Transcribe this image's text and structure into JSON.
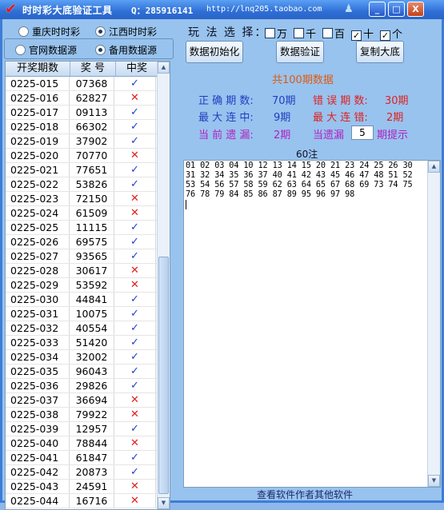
{
  "titlebar": {
    "title": "时时彩大底验证工具",
    "qq": "Q：285916141",
    "url": "http://lnq205.taobao.com",
    "min_label": "_",
    "max_label": "□",
    "close_label": "X"
  },
  "lottery_options": [
    {
      "label": "重庆时时彩",
      "selected": false
    },
    {
      "label": "江西时时彩",
      "selected": true
    }
  ],
  "source_options": [
    {
      "label": "官网数据源",
      "selected": false
    },
    {
      "label": "备用数据源",
      "selected": true
    }
  ],
  "grid": {
    "headers": [
      "开奖期数",
      "奖 号",
      "中奖"
    ],
    "rows": [
      {
        "period": "0225-015",
        "number": "07368",
        "hit": "✓"
      },
      {
        "period": "0225-016",
        "number": "62827",
        "hit": "✕"
      },
      {
        "period": "0225-017",
        "number": "09113",
        "hit": "✓"
      },
      {
        "period": "0225-018",
        "number": "66302",
        "hit": "✓"
      },
      {
        "period": "0225-019",
        "number": "37902",
        "hit": "✓"
      },
      {
        "period": "0225-020",
        "number": "70770",
        "hit": "✕"
      },
      {
        "period": "0225-021",
        "number": "77651",
        "hit": "✓"
      },
      {
        "period": "0225-022",
        "number": "53826",
        "hit": "✓"
      },
      {
        "period": "0225-023",
        "number": "72150",
        "hit": "✕"
      },
      {
        "period": "0225-024",
        "number": "61509",
        "hit": "✕"
      },
      {
        "period": "0225-025",
        "number": "11115",
        "hit": "✓"
      },
      {
        "period": "0225-026",
        "number": "69575",
        "hit": "✓"
      },
      {
        "period": "0225-027",
        "number": "93565",
        "hit": "✓"
      },
      {
        "period": "0225-028",
        "number": "30617",
        "hit": "✕"
      },
      {
        "period": "0225-029",
        "number": "53592",
        "hit": "✕"
      },
      {
        "period": "0225-030",
        "number": "44841",
        "hit": "✓"
      },
      {
        "period": "0225-031",
        "number": "10075",
        "hit": "✓"
      },
      {
        "period": "0225-032",
        "number": "40554",
        "hit": "✓"
      },
      {
        "period": "0225-033",
        "number": "51420",
        "hit": "✓"
      },
      {
        "period": "0225-034",
        "number": "32002",
        "hit": "✓"
      },
      {
        "period": "0225-035",
        "number": "96043",
        "hit": "✓"
      },
      {
        "period": "0225-036",
        "number": "29826",
        "hit": "✓"
      },
      {
        "period": "0225-037",
        "number": "36694",
        "hit": "✕"
      },
      {
        "period": "0225-038",
        "number": "79922",
        "hit": "✕"
      },
      {
        "period": "0225-039",
        "number": "12957",
        "hit": "✓"
      },
      {
        "period": "0225-040",
        "number": "78844",
        "hit": "✕"
      },
      {
        "period": "0225-041",
        "number": "61847",
        "hit": "✓"
      },
      {
        "period": "0225-042",
        "number": "20873",
        "hit": "✓"
      },
      {
        "period": "0225-043",
        "number": "24591",
        "hit": "✕"
      },
      {
        "period": "0225-044",
        "number": "16716",
        "hit": "✕"
      }
    ]
  },
  "play_method": {
    "label": "玩 法 选 择：",
    "positions": [
      {
        "label": "万",
        "checked": false
      },
      {
        "label": "千",
        "checked": false
      },
      {
        "label": "百",
        "checked": false
      },
      {
        "label": "十",
        "checked": true
      },
      {
        "label": "个",
        "checked": true
      }
    ]
  },
  "buttons": {
    "init": "数据初始化",
    "verify": "数据验证",
    "copy": "复制大底"
  },
  "summary": {
    "total": "共100期数据",
    "correct_label": "正 确 期 数:",
    "correct_value": "70期",
    "wrong_label": "错 误 期 数:",
    "wrong_value": "30期",
    "max_hit_label": "最 大 连 中:",
    "max_hit_value": "9期",
    "max_miss_label": "最 大 连 错:",
    "max_miss_value": "2期",
    "current_miss_label": "当 前 遗 漏:",
    "current_miss_value": "2期",
    "miss_alert_label": "当遗漏",
    "miss_alert_value": "5",
    "miss_alert_suffix": "期提示"
  },
  "numbers": {
    "count": "60注",
    "text": "01 02 03 04 10 12 13 14 15 20 21 23 24 25 26 30 31 32 34 35 36 37 40 41 42 43 45 46 47 48 51 52 53 54 56 57 58 59 62 63 64 65 67 68 69 73 74 75 76 78 79 84 85 86 87 89 95 96 97 98"
  },
  "footer": "查看软件作者其他软件"
}
